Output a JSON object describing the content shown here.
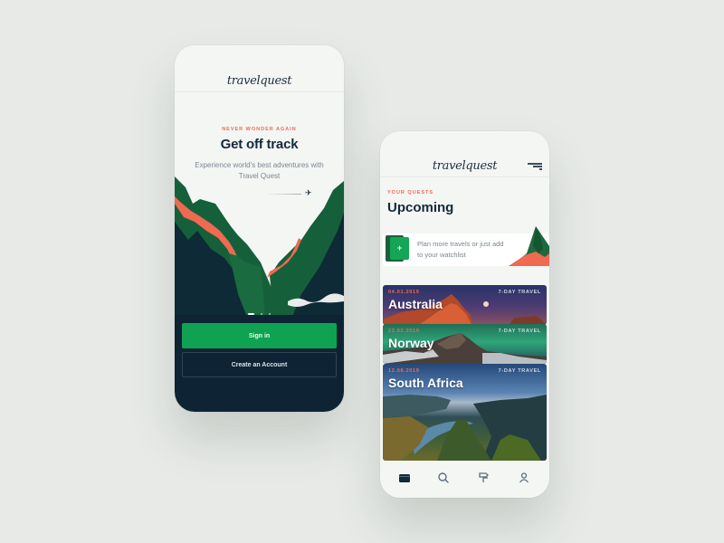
{
  "colors": {
    "background": "#e7eae7",
    "accent_green": "#0fa253",
    "accent_coral": "#ef6a50",
    "navy": "#14293a",
    "dark_bottom": "#0e2434"
  },
  "welcome_screen": {
    "logo": "travelquest",
    "eyebrow": "NEVER WONDER AGAIN",
    "title": "Get off track",
    "subtitle": "Experience world's best adventures with Travel Quest",
    "illustration": "mountain-valley",
    "carousel": {
      "pages": 3,
      "active": 1
    },
    "buttons": {
      "sign_in": "Sign in",
      "create_account": "Create an Account"
    }
  },
  "quests_screen": {
    "logo": "travelquest",
    "menu_icon": "menu-icon",
    "eyebrow": "YOUR QUESTS",
    "title": "Upcoming",
    "plan_card": {
      "icon": "add-folder-icon",
      "button_label": "+",
      "text": "Plan more travels or just add to your watchlist"
    },
    "quests": [
      {
        "date": "04.01.2019",
        "name": "Australia",
        "tag": "7-DAY TRAVEL"
      },
      {
        "date": "23.02.2019",
        "name": "Norway",
        "tag": "7-DAY TRAVEL"
      },
      {
        "date": "12.08.2019",
        "name": "South Africa",
        "tag": "7-DAY TRAVEL"
      }
    ],
    "tabbar": [
      {
        "name": "wallet-icon",
        "active": true
      },
      {
        "name": "search-icon",
        "active": false
      },
      {
        "name": "signpost-icon",
        "active": false
      },
      {
        "name": "user-icon",
        "active": false
      }
    ]
  }
}
